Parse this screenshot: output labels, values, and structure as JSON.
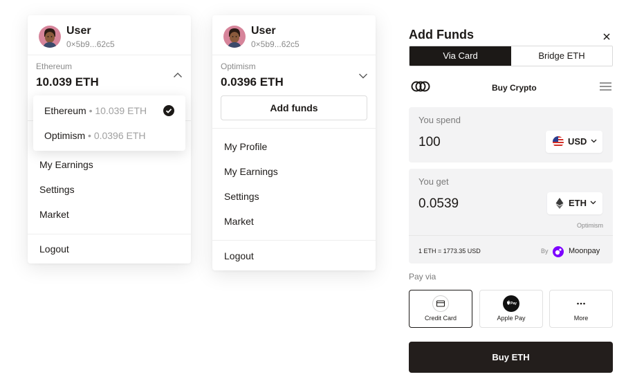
{
  "menu_a": {
    "user": {
      "name": "User",
      "address": "0×5b9...62c5"
    },
    "network": {
      "label": "Ethereum",
      "balance": "10.039 ETH"
    },
    "dropdown": [
      {
        "name": "Ethereum",
        "sep": "•",
        "balance": "10.039 ETH",
        "selected": true
      },
      {
        "name": "Optimism",
        "sep": "•",
        "balance": "0.0396 ETH",
        "selected": false
      }
    ],
    "items": [
      "My Earnings",
      "Settings",
      "Market"
    ],
    "logout": "Logout"
  },
  "menu_b": {
    "user": {
      "name": "User",
      "address": "0×5b9...62c5"
    },
    "network": {
      "label": "Optimism",
      "balance": "0.0396 ETH"
    },
    "add_funds": "Add funds",
    "items": [
      "My Profile",
      "My Earnings",
      "Settings",
      "Market"
    ],
    "logout": "Logout"
  },
  "add_funds_panel": {
    "title": "Add Funds",
    "tabs": [
      {
        "label": "Via Card",
        "active": true
      },
      {
        "label": "Bridge ETH",
        "active": false
      }
    ],
    "provider_title": "Buy Crypto",
    "spend": {
      "label": "You spend",
      "amount": "100",
      "currency": "USD",
      "icon": "us-flag-icon"
    },
    "get": {
      "label": "You get",
      "amount": "0.0539",
      "currency": "ETH",
      "icon": "ethereum-icon",
      "network": "Optimism"
    },
    "rate": "1 ETH = 1773.35 USD",
    "by_label": "By",
    "provider_name": "Moonpay",
    "pay_via_label": "Pay via",
    "pay_options": [
      {
        "label": "Credit Card",
        "icon": "credit-card-icon",
        "selected": true
      },
      {
        "label": "Apple Pay",
        "icon": "apple-pay-icon",
        "selected": false
      },
      {
        "label": "More",
        "icon": "more-dots-icon",
        "selected": false
      }
    ],
    "buy_button": "Buy ETH"
  },
  "colors": {
    "primary": "#1c1917",
    "muted": "#8a8a8a",
    "box_bg": "#f3f3f4",
    "moonpay": "#7d00ff",
    "avatar_bg": "#d6849a"
  }
}
